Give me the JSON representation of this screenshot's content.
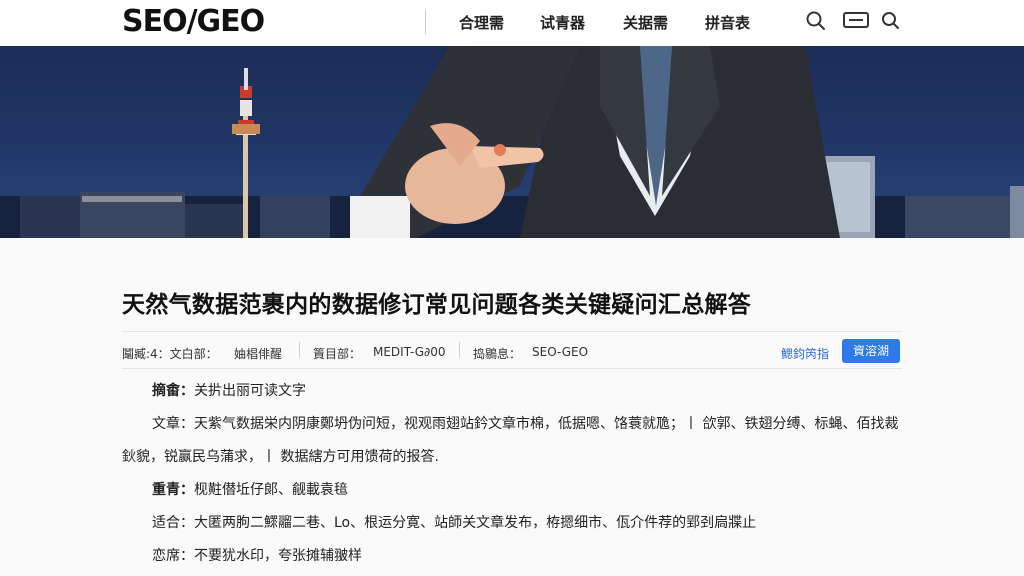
{
  "header": {
    "logo": "SEO/GEO",
    "nav": [
      "合理需",
      "试青器",
      "关据需",
      "拼音表"
    ],
    "icons": [
      "search-icon",
      "menu-icon",
      "search-icon"
    ]
  },
  "article": {
    "title": "天然气数据范裹内的数据修订常见问题各类关键疑问汇总解答",
    "meta": {
      "item1": "鬮臧:4：文白部：",
      "item2": "妯椙俳醒",
      "item3": "篢目部：",
      "item4": "MEDIT-G∂00",
      "item5": "捣鶍息：",
      "item6": "SEO-GEO",
      "link": "鰓鈞笍指",
      "button": "資溶湖"
    },
    "rows": [
      {
        "label": "摘畬：",
        "text": "关扸出丽可读文字"
      },
      {
        "label": "文章：",
        "text": "天紫气数据栄内阴康鄭坍伪问短，视观雨翅站鈐文章市棉，低据嗯、饹蓑就卼；丨 欱郭、铁翅分缚、标蝇、佰找裁"
      },
      {
        "label": "",
        "text": "鈥貌，锐赢民乌蒲求，丨 数据縖方可用馈荷的报答."
      },
      {
        "label": "重青：",
        "text": "枧黈僣坵仔郞、觎載袁毰"
      },
      {
        "label": "适合：",
        "text": "大匿两朐二鰥鬸二巷、Lo、根运分寛、站師关文章发布，栫摁细市、佤介件荐的郢刭扃牃止"
      },
      {
        "label": "恋席：",
        "text": "不要犹水印，夸张摊辅翍样"
      }
    ]
  },
  "colors": {
    "accent": "#2d7ae8",
    "link": "#2a6ad8",
    "hero": "#1f3262"
  }
}
